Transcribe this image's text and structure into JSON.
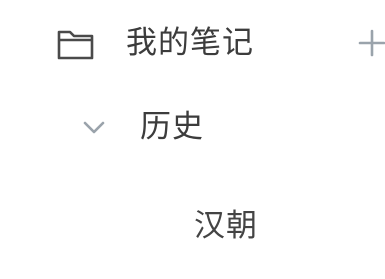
{
  "sidebar": {
    "notebook": {
      "label": "我的笔记",
      "icon": "folder-icon",
      "action_icon": "plus-icon"
    },
    "folder": {
      "label": "历史",
      "icon": "chevron-down-icon",
      "expanded": true
    },
    "notes": [
      {
        "label": "汉朝"
      }
    ]
  },
  "colors": {
    "text": "#3c3c3c",
    "icon": "#4a4a4a",
    "chevron": "#9aa3ab",
    "plus": "#9aa3ab",
    "background": "#ffffff"
  }
}
